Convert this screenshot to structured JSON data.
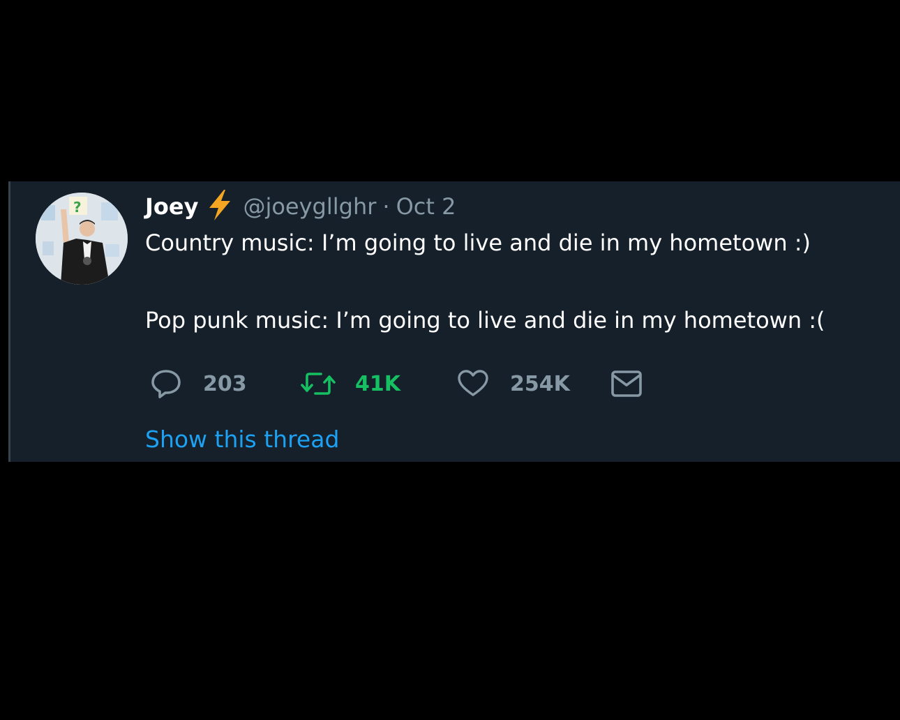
{
  "tweet": {
    "author": {
      "name": "Joey",
      "handle": "@joeygllghr"
    },
    "separator": "·",
    "date": "Oct 2",
    "lines": [
      "Country music: I’m going to live and die in my hometown :)",
      "Pop punk music: I’m going to live and die in my hometown :("
    ],
    "actions": {
      "replies": "203",
      "retweets": "41K",
      "likes": "254K"
    },
    "show_thread": "Show this thread"
  },
  "icons": {
    "verified_emoji": "high-voltage-icon",
    "reply": "speech-bubble-icon",
    "retweet": "retweet-icon",
    "like": "heart-icon",
    "dm": "envelope-icon"
  },
  "colors": {
    "background": "#15202b",
    "text": "#ffffff",
    "secondary": "#8899a6",
    "retweet_active": "#17bf63",
    "link": "#1da1f2",
    "bolt": "#f4a623"
  }
}
